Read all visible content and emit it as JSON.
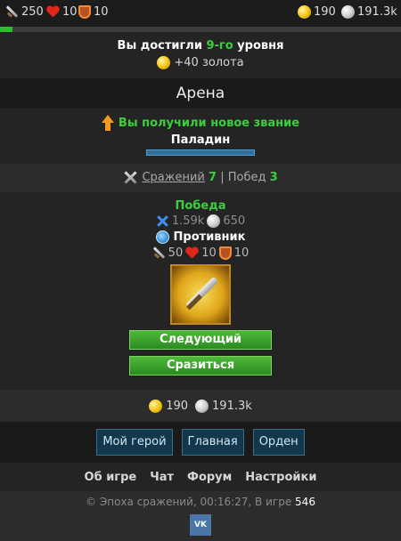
{
  "topbar": {
    "attack": "250",
    "health": "10",
    "defense": "10",
    "gold": "190",
    "silver": "191.3k",
    "xp_progress": 0.03
  },
  "level_up": {
    "prefix": "Вы достигли ",
    "level": "9-го",
    "suffix": " уровня",
    "reward": "+40 золота"
  },
  "page_title": "Арена",
  "rank": {
    "message": "Вы получили новое звание",
    "name": "Паладин"
  },
  "battles": {
    "label": "Сражений",
    "count": "7",
    "sep": "|",
    "wins_label": "Побед",
    "wins": "3"
  },
  "result": {
    "status": "Победа",
    "exp": "1.59k",
    "silver": "650",
    "opponent_label": "Противник",
    "opponent_attack": "50",
    "opponent_health": "10",
    "opponent_defense": "10",
    "next_button": "Следующий",
    "fight_button": "Сразиться"
  },
  "money": {
    "gold": "190",
    "silver": "191.3k"
  },
  "nav": {
    "hero": "Мой герой",
    "main": "Главная",
    "order": "Орден"
  },
  "links": {
    "about": "Об игре",
    "chat": "Чат",
    "forum": "Форум",
    "settings": "Настройки"
  },
  "footer": {
    "copyright": "© Эпоха сражений, 00:16:27, В игре",
    "online": "546",
    "vk": "VK"
  },
  "colors": {
    "accent_green": "#3ccf3c",
    "nav_button": "#13384d",
    "gold_frame": "#c08a1a"
  }
}
